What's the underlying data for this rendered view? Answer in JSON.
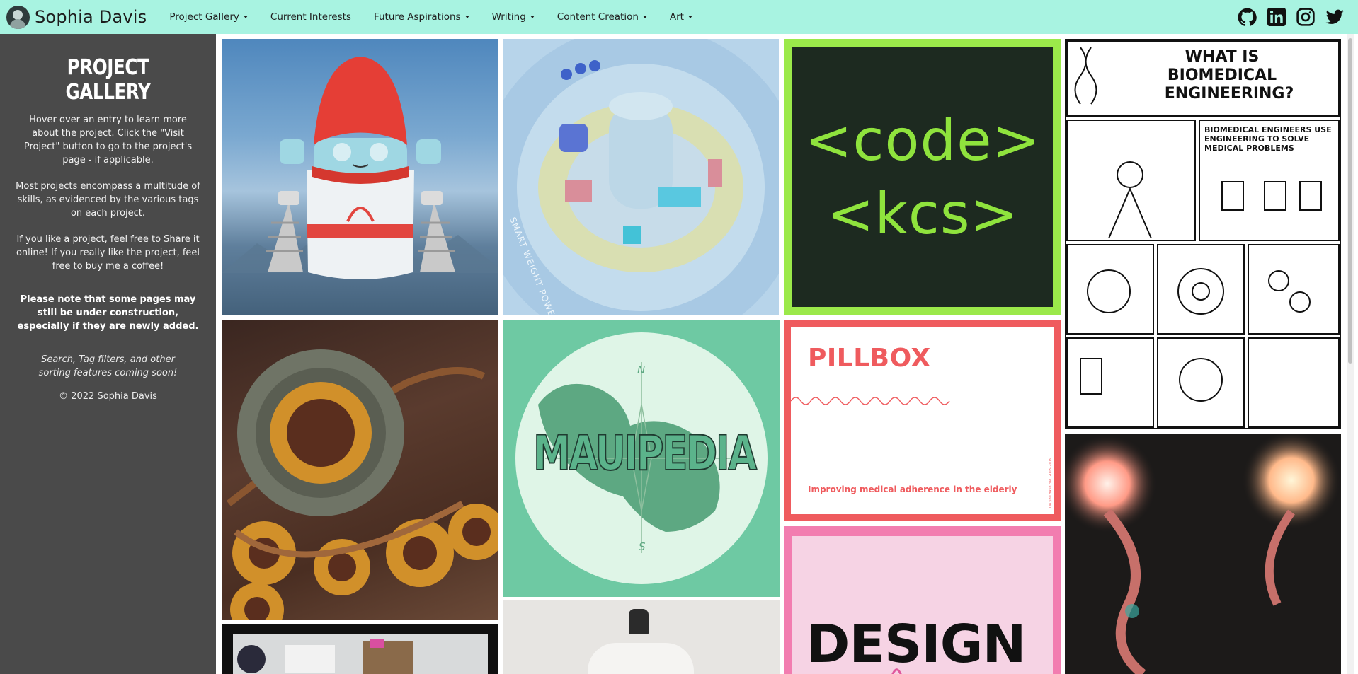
{
  "brand": {
    "name": "Sophia Davis"
  },
  "nav": {
    "items": [
      {
        "label": "Project Gallery",
        "has_dropdown": true
      },
      {
        "label": "Current Interests",
        "has_dropdown": false
      },
      {
        "label": "Future Aspirations",
        "has_dropdown": true
      },
      {
        "label": "Writing",
        "has_dropdown": true
      },
      {
        "label": "Content Creation",
        "has_dropdown": true
      },
      {
        "label": "Art",
        "has_dropdown": true
      }
    ]
  },
  "social": [
    "github-icon",
    "linkedin-icon",
    "instagram-icon",
    "twitter-icon"
  ],
  "sidebar": {
    "title": "PROJECT GALLERY",
    "p1": "Hover over an entry to learn more about the project. Click the \"Visit Project\" button to go to the project's page - if applicable.",
    "p2": "Most projects encompass a multitude of skills, as evidenced by the various tags on each project.",
    "p3": "If you like a project, feel free to Share it online! If you really like the project, feel free to buy me a coffee!",
    "note": "Please note that some pages may still be under construction, especially if they are newly added.",
    "coming_soon": "Search, Tag filters, and other sorting features coming soon!",
    "copyright": "© 2022 Sophia Davis"
  },
  "tiles": {
    "city_caption": "SMART WEIGHT POWER ROAD",
    "code_line1": "<code>",
    "code_line2": "<kcs>",
    "bme_title_1": "WHAT IS",
    "bme_title_2": "BIOMEDICAL",
    "bme_title_3": "ENGINEERING?",
    "bme_use": "BIOMEDICAL ENGINEERS USE ENGINEERING TO SOLVE MEDICAL PROBLEMS",
    "maui_title": "MAUIPEDIA",
    "maui_n": "N",
    "maui_s": "S",
    "pill_title": "PILLBOX",
    "pill_sub": "Improving medical adherence in the elderly",
    "pill_side": "Do you have the GUTS 2019",
    "design_word": "DESIGN"
  },
  "colors": {
    "navbar_bg": "#a8f3e1",
    "sidebar_bg": "#4a4a4a",
    "code_green": "#8fe33d",
    "pill_red": "#ef5b5e",
    "maui_green": "#6ec9a3",
    "design_pink": "#f27db0"
  }
}
